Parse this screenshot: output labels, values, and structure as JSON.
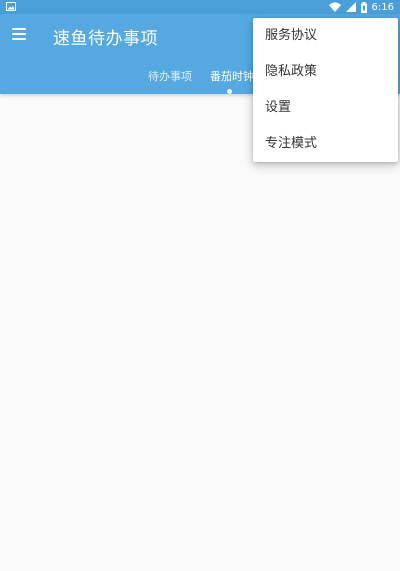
{
  "status_bar": {
    "time": "6:16",
    "colors": {
      "background": "#4a9fd8"
    },
    "icons": [
      "image-icon",
      "wifi-icon",
      "signal-icon",
      "battery-icon"
    ]
  },
  "app_bar": {
    "title": "速鱼待办事项",
    "menu_icon": "hamburger-menu-icon",
    "colors": {
      "background": "#56a9e0"
    }
  },
  "tabs": [
    {
      "label": "待办事项",
      "active": false
    },
    {
      "label": "番茄时钟",
      "active": true
    }
  ],
  "overflow_menu": {
    "items": [
      {
        "label": "服务协议"
      },
      {
        "label": "隐私政策"
      },
      {
        "label": "设置"
      },
      {
        "label": "专注模式"
      }
    ]
  }
}
